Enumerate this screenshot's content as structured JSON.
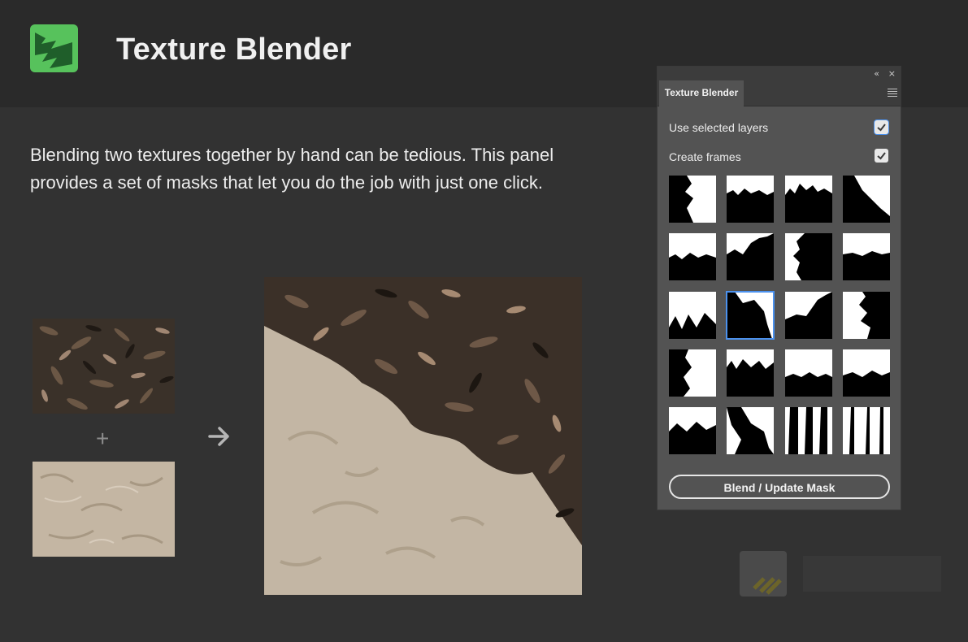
{
  "app": {
    "title": "Texture Blender",
    "description": "Blending two textures together by hand can be tedious. This panel provides a set of masks that let you do the job with just one click.",
    "plus_symbol": "+"
  },
  "panel": {
    "tab_label": "Texture Blender",
    "collapse_label": "«",
    "close_label": "×",
    "options": [
      {
        "label": "Use selected layers",
        "checked": true
      },
      {
        "label": "Create frames",
        "checked": true
      }
    ],
    "selected_mask_index": 9,
    "blend_button_label": "Blend / Update Mask"
  },
  "colors": {
    "accent": "#4b91ee",
    "logo_green": "#57c25c",
    "panel_bg": "#535353",
    "page_bg": "#323232"
  }
}
